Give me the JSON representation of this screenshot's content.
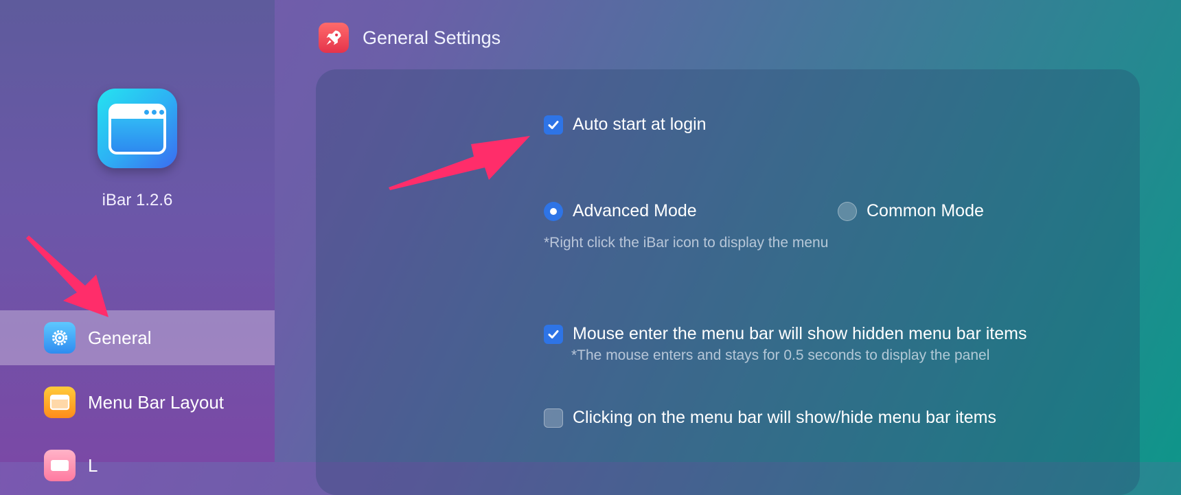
{
  "sidebar": {
    "app_version": "iBar 1.2.6",
    "items": [
      {
        "label": "General",
        "icon": "gear-icon",
        "active": true
      },
      {
        "label": "Menu Bar Layout",
        "icon": "window-icon",
        "active": false
      },
      {
        "label": "L",
        "icon": "keyboard-icon",
        "active": false
      }
    ]
  },
  "header": {
    "title": "General Settings",
    "icon": "rocket-icon"
  },
  "settings": {
    "auto_start": {
      "label": "Auto start at login",
      "checked": true
    },
    "mode": {
      "advanced_label": "Advanced Mode",
      "common_label": "Common Mode",
      "selected": "Advanced Mode",
      "hint": "*Right click the iBar icon to display the menu"
    },
    "mouse_enter": {
      "label": "Mouse enter the menu bar will show hidden menu bar items",
      "checked": true,
      "hint": "*The mouse enters and stays for 0.5 seconds to display the panel"
    },
    "click_toggle": {
      "label": "Clicking on the menu bar will show/hide menu bar items",
      "checked": false
    }
  },
  "colors": {
    "accent": "#2e74e6",
    "annotation_arrow": "#ff2d6a"
  }
}
